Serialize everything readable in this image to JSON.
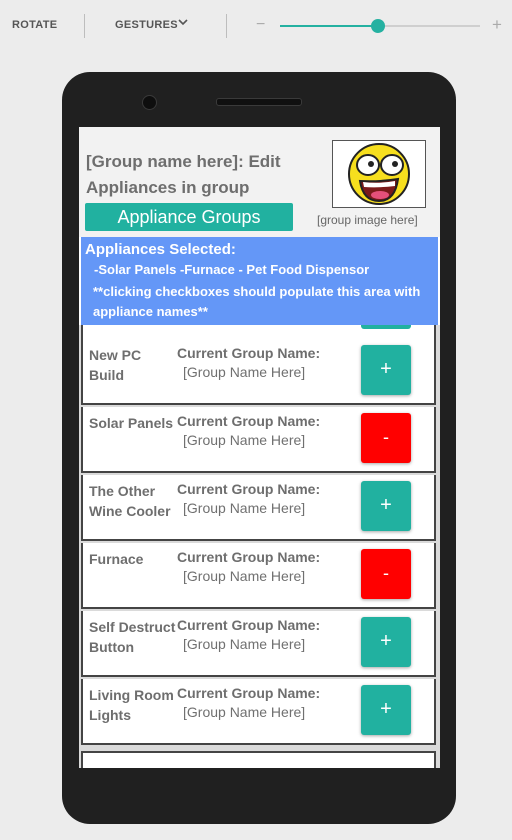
{
  "toolbar": {
    "rotate_label": "ROTATE",
    "gestures_label": "GESTURES",
    "zoom_minus": "−",
    "zoom_plus": "+",
    "zoom_level": 0.49
  },
  "header": {
    "title": "[Group name here]: Edit Appliances in group",
    "groups_button": "Appliance Groups",
    "image_caption": "[group image here]"
  },
  "selected": {
    "title": "Appliances Selected:",
    "list": "-Solar Panels  -Furnace  - Pet Food Dispensor",
    "note": "**clicking checkboxes should populate this area with appliance names**"
  },
  "appliances": [
    {
      "name": "New PC Build",
      "current_label": "Current Group Name:",
      "current_value": "[Group Name Here]",
      "action": "+"
    },
    {
      "name": "Solar Panels",
      "current_label": "Current Group Name:",
      "current_value": "[Group Name Here]",
      "action": "-"
    },
    {
      "name": "The Other Wine Cooler",
      "current_label": "Current Group Name:",
      "current_value": "[Group Name Here]",
      "action": "+"
    },
    {
      "name": "Furnace",
      "current_label": "Current Group Name:",
      "current_value": "[Group Name Here]",
      "action": "-"
    },
    {
      "name": "Self Destruct Button",
      "current_label": "Current Group Name:",
      "current_value": "[Group Name Here]",
      "action": "+"
    },
    {
      "name": "Living Room Lights",
      "current_label": "Current Group Name:",
      "current_value": "[Group Name Here]",
      "action": "+"
    }
  ],
  "colors": {
    "accent": "#21b1a0",
    "remove": "#ff0000",
    "selected_bg": "#6497f7"
  }
}
